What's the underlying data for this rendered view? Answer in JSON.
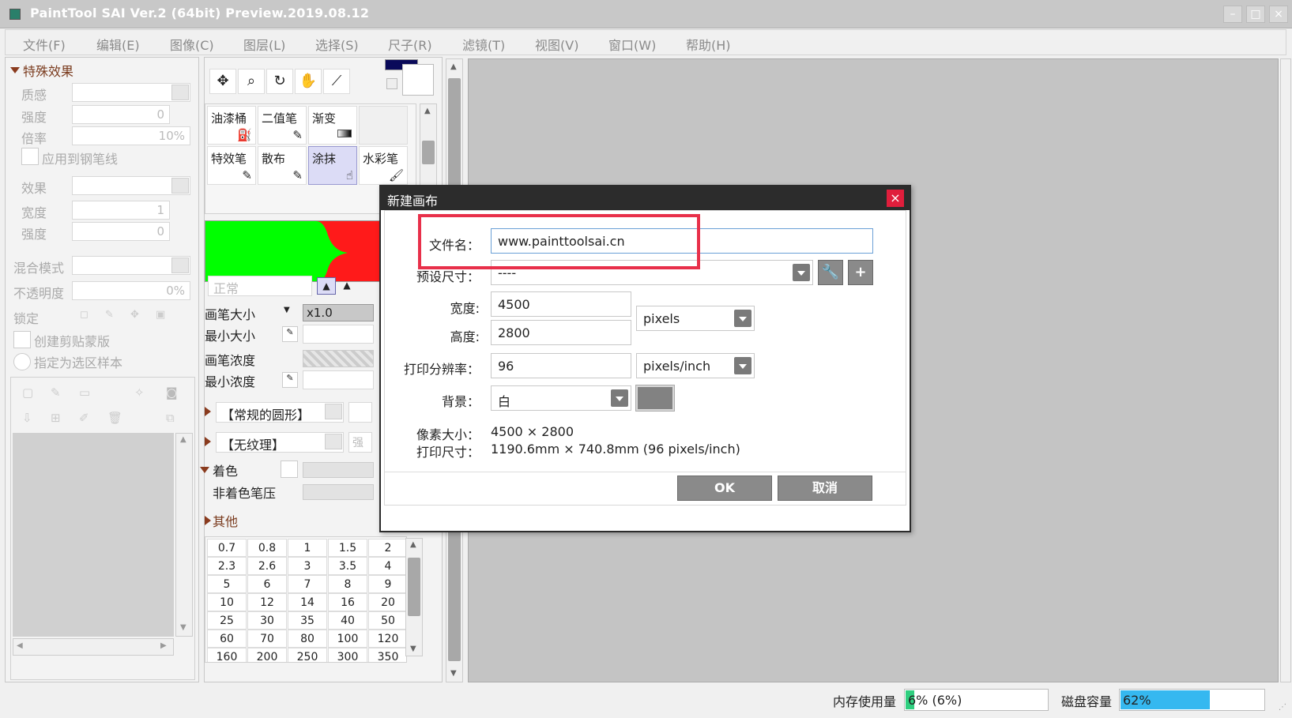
{
  "window": {
    "title": "PaintTool SAI Ver.2 (64bit) Preview.2019.08.12"
  },
  "menu": [
    "文件(F)",
    "编辑(E)",
    "图像(C)",
    "图层(L)",
    "选择(S)",
    "尺子(R)",
    "滤镜(T)",
    "视图(V)",
    "窗口(W)",
    "帮助(H)"
  ],
  "effects_panel": {
    "header": "特殊效果",
    "texture_label": "质感",
    "strength_label": "强度",
    "strength_value": "0",
    "rate_label": "倍率",
    "rate_value": "10%",
    "apply_pen_label": "应用到钢笔线",
    "effect_label": "效果",
    "width_label": "宽度",
    "width_value": "1",
    "strength2_label": "强度",
    "strength2_value": "0"
  },
  "layer_panel": {
    "blend_label": "混合模式",
    "opacity_label": "不透明度",
    "opacity_value": "0%",
    "lock_label": "锁定",
    "clip_label": "创建剪贴蒙版",
    "sample_label": "指定为选区样本"
  },
  "tools": {
    "row1": [
      "油漆桶",
      "二值笔",
      "渐变"
    ],
    "row2": [
      "特效笔",
      "散布",
      "涂抹",
      "水彩笔"
    ]
  },
  "brush": {
    "mode": "正常",
    "size_label": "画笔大小",
    "size_mult": "x1.0",
    "min_size_label": "最小大小",
    "density_label": "画笔浓度",
    "min_density_label": "最小浓度",
    "shape": "【常规的圆形】",
    "texture": "【无纹理】",
    "texture_side": "强",
    "color_label": "着色",
    "non_color_label": "非着色笔压",
    "other_label": "其他"
  },
  "sizes": [
    [
      "0.7",
      "0.8",
      "1",
      "1.5",
      "2"
    ],
    [
      "2.3",
      "2.6",
      "3",
      "3.5",
      "4"
    ],
    [
      "5",
      "6",
      "7",
      "8",
      "9"
    ],
    [
      "10",
      "12",
      "14",
      "16",
      "20"
    ],
    [
      "25",
      "30",
      "35",
      "40",
      "50"
    ],
    [
      "60",
      "70",
      "80",
      "100",
      "120"
    ],
    [
      "160",
      "200",
      "250",
      "300",
      "350"
    ]
  ],
  "colors": {
    "primary": "#0a0a5a",
    "swatch_green": "#00ff00",
    "swatch_red": "#ff1a1a",
    "highlight": "#e8304a",
    "memory_fill": "#2fcf7f",
    "disk_fill": "#35b8f0"
  },
  "dialog": {
    "title": "新建画布",
    "close": "×",
    "filename_label": "文件名：",
    "filename_value": "www.painttoolsai.cn",
    "preset_label": "预设尺寸：",
    "preset_value": "----",
    "width_label": "宽度:",
    "width_value": "4500",
    "height_label": "高度:",
    "height_value": "2800",
    "unit": "pixels",
    "dpi_label": "打印分辨率：",
    "dpi_value": "96",
    "dpi_unit": "pixels/inch",
    "bg_label": "背景：",
    "bg_value": "白",
    "pixel_size_label": "像素大小：",
    "pixel_size_value": "4500 × 2800",
    "print_size_label": "打印尺寸：",
    "print_size_value": "1190.6mm × 740.8mm (96 pixels/inch)",
    "ok": "OK",
    "cancel": "取消"
  },
  "status": {
    "memory_label": "内存使用量",
    "memory_value": "6% (6%)",
    "memory_fraction": 0.06,
    "disk_label": "磁盘容量",
    "disk_value": "62%",
    "disk_fraction": 0.62
  }
}
